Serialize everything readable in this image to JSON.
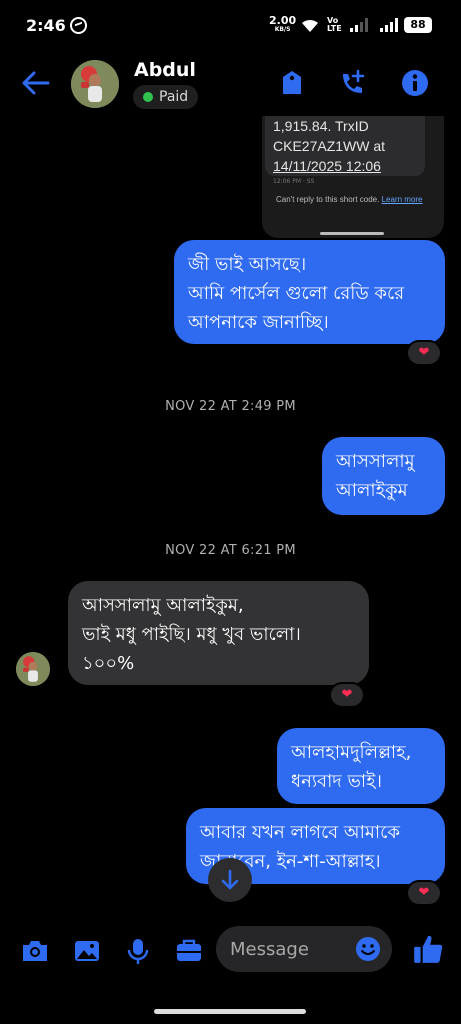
{
  "status_bar": {
    "time": "2:46",
    "net_speed": "2.00",
    "net_unit": "KB/S",
    "volte_line1": "Vo",
    "volte_line2": "LTE",
    "battery": "88"
  },
  "header": {
    "contact_name": "Abdul",
    "badge": "Paid",
    "badge_color": "#31c24e",
    "accent": "#2f6bf0"
  },
  "shared_screenshot": {
    "line1": "1,915.84. TrxID",
    "line2": "CKE27AZ1WW at",
    "line3": "14/11/2025 12:06",
    "time_small": "12:06 PM · SS",
    "note": "Can't reply to this short code.",
    "note_link": "Learn more"
  },
  "messages": [
    {
      "id": "m1",
      "dir": "out",
      "lines": [
        "জী ভাই আসছে।",
        "আমি পার্সেল গুলো রেডি করে",
        "আপনাকে জানাচ্ছি।"
      ],
      "reaction": "❤"
    },
    {
      "id": "t1",
      "timestamp": "NOV 22 AT 2:49 PM"
    },
    {
      "id": "m2",
      "dir": "out",
      "lines": [
        "আসসালামু",
        "আলাইকুম"
      ]
    },
    {
      "id": "t2",
      "timestamp": "NOV 22 AT 6:21 PM"
    },
    {
      "id": "m3",
      "dir": "in",
      "lines": [
        "আসসালামু আলাইকুম,",
        "ভাই মধু পাইছি। মধু খুব ভালো।",
        "১০০%"
      ],
      "reaction": "❤"
    },
    {
      "id": "m4",
      "dir": "out",
      "lines": [
        "আলহামদুলিল্লাহ,",
        "ধন্যবাদ ভাই।"
      ]
    },
    {
      "id": "m5",
      "dir": "out",
      "lines": [
        "আবার যখন লাগবে আমাকে",
        "জানাবেন, ইন-শা-আল্লাহ।"
      ],
      "reaction": "❤"
    }
  ],
  "composer": {
    "placeholder": "Message",
    "icons": [
      "camera-icon",
      "gallery-icon",
      "microphone-icon",
      "briefcase-icon",
      "emoji-icon",
      "thumbs-up-icon"
    ]
  }
}
